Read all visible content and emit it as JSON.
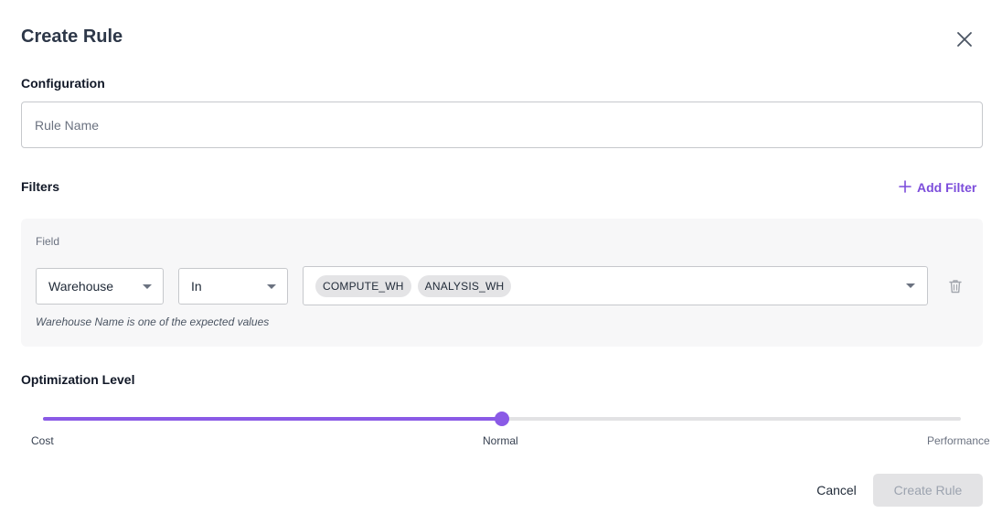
{
  "dialog": {
    "title": "Create Rule",
    "close_icon": "close-icon"
  },
  "configuration": {
    "label": "Configuration",
    "rule_name": {
      "value": "",
      "placeholder": "Rule Name"
    }
  },
  "filters": {
    "label": "Filters",
    "add_filter_label": "Add Filter",
    "add_icon": "plus-icon",
    "items": [
      {
        "field_label": "Field",
        "field": "Warehouse",
        "operator": "In",
        "values": [
          "COMPUTE_WH",
          "ANALYSIS_WH"
        ],
        "hint": "Warehouse Name is one of the expected values",
        "delete_icon": "trash-icon"
      }
    ]
  },
  "optimization": {
    "label": "Optimization Level",
    "ticks": [
      "Cost",
      "Normal",
      "Performance"
    ],
    "selected": "Normal",
    "level_fraction": 0.5
  },
  "footer": {
    "cancel_label": "Cancel",
    "create_label": "Create Rule"
  },
  "colors": {
    "accent": "#8a5ae6",
    "link": "#7c4ddb",
    "disabled_button_bg": "#e3e3e5"
  }
}
